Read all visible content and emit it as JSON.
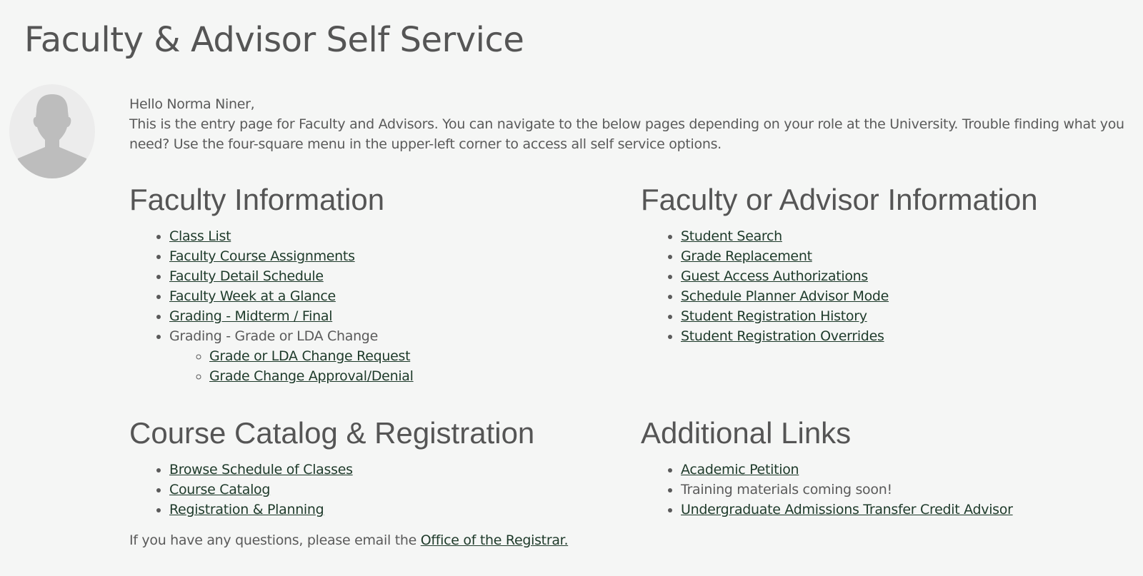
{
  "page": {
    "title": "Faculty & Advisor Self Service"
  },
  "intro": {
    "greeting": "Hello Norma Niner,",
    "description": "This is the entry page for Faculty and Advisors. You can navigate to the below pages depending on your role at the University. Trouble finding what you need? Use the four-square menu in the upper-left corner to access all self service options."
  },
  "sections": {
    "faculty": {
      "heading": "Faculty Information",
      "items": [
        {
          "label": "Class List"
        },
        {
          "label": "Faculty Course Assignments"
        },
        {
          "label": "Faculty Detail Schedule"
        },
        {
          "label": "Faculty Week at a Glance"
        },
        {
          "label": "Grading - Midterm / Final"
        },
        {
          "label": "Grading - Grade or LDA Change",
          "subitems": [
            {
              "label": "Grade or LDA Change Request"
            },
            {
              "label": "Grade Change Approval/Denial"
            }
          ]
        }
      ]
    },
    "advisor": {
      "heading": "Faculty or Advisor Information",
      "items": [
        {
          "label": "Student Search"
        },
        {
          "label": "Grade Replacement"
        },
        {
          "label": "Guest Access Authorizations"
        },
        {
          "label": "Schedule Planner Advisor Mode"
        },
        {
          "label": "Student Registration History"
        },
        {
          "label": "Student Registration Overrides"
        }
      ]
    },
    "catalog": {
      "heading": "Course Catalog & Registration",
      "items": [
        {
          "label": "Browse Schedule of Classes"
        },
        {
          "label": "Course Catalog"
        },
        {
          "label": "Registration & Planning"
        }
      ]
    },
    "additional": {
      "heading": "Additional Links",
      "items": [
        {
          "label": "Academic Petition"
        },
        {
          "label": "Training materials coming soon!"
        },
        {
          "label": "Undergraduate Admissions Transfer Credit Advisor"
        }
      ]
    }
  },
  "footer": {
    "prefix": "If you have any questions, please email the ",
    "link_label": "Office of the Registrar."
  },
  "colors": {
    "link": "#1e3a2a",
    "text": "#5a5a5a",
    "background": "#f5f6f5"
  }
}
